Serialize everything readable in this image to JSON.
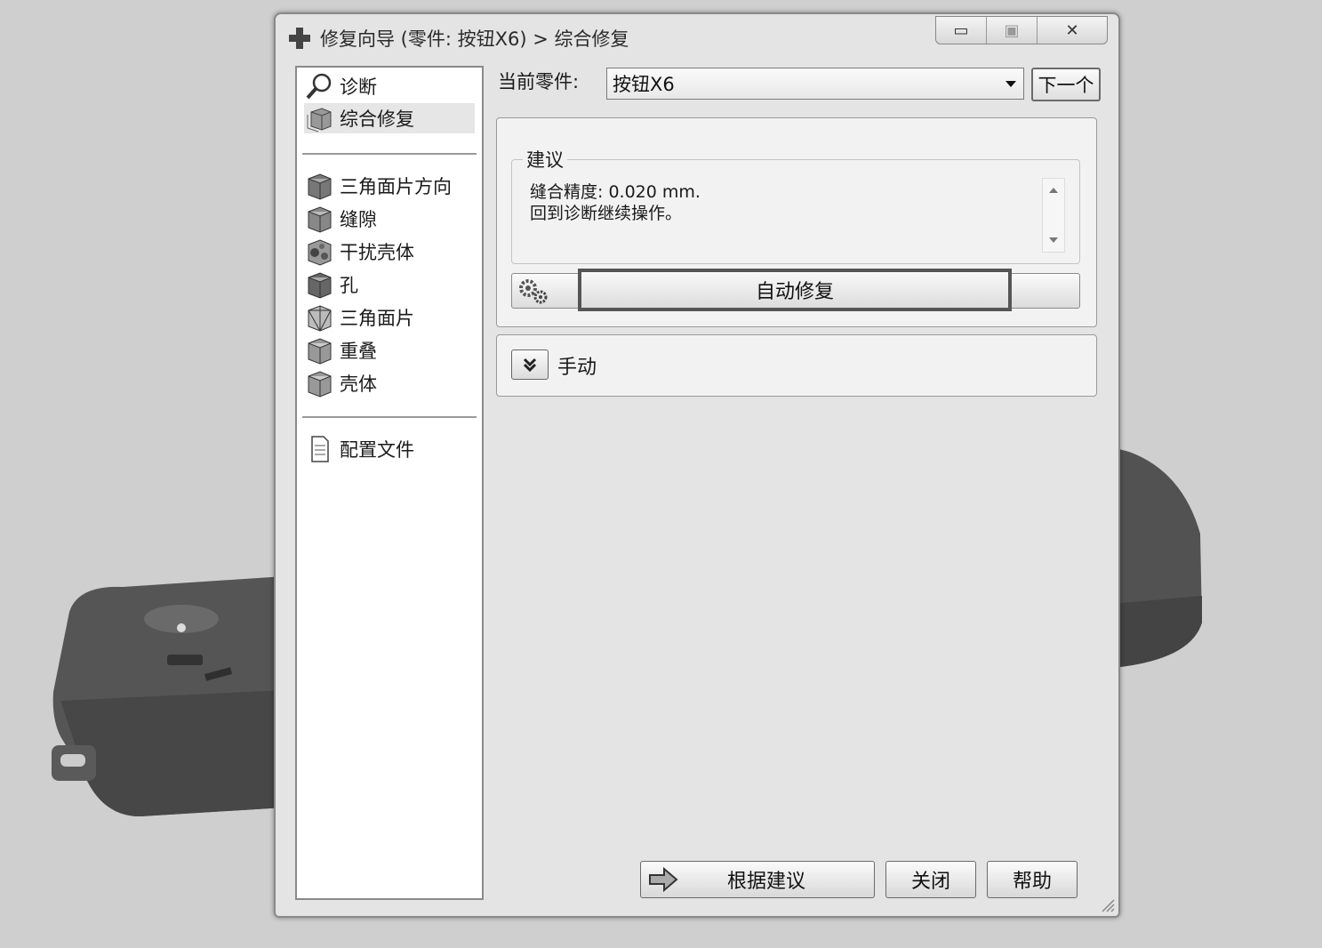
{
  "window": {
    "title": "修复向导 (零件: 按钮X6) > 综合修复"
  },
  "sidebar": {
    "group1": [
      {
        "label": "诊断",
        "icon": "magnifier-icon"
      },
      {
        "label": "综合修复",
        "icon": "cube-stack-icon",
        "selected": true
      }
    ],
    "group2": [
      {
        "label": "三角面片方向",
        "icon": "cube-icon"
      },
      {
        "label": "缝隙",
        "icon": "cube-icon"
      },
      {
        "label": "干扰壳体",
        "icon": "gear-cube-icon"
      },
      {
        "label": "孔",
        "icon": "cube-icon"
      },
      {
        "label": "三角面片",
        "icon": "wireframe-cube-icon"
      },
      {
        "label": "重叠",
        "icon": "cube-icon"
      },
      {
        "label": "壳体",
        "icon": "cube-icon"
      }
    ],
    "group3": [
      {
        "label": "配置文件",
        "icon": "document-icon"
      }
    ]
  },
  "header": {
    "current_part_label": "当前零件:",
    "current_part_value": "按钮X6",
    "next_label": "下一个"
  },
  "suggestion": {
    "title": "建议",
    "line1": "缝合精度:  0.020 mm.",
    "line2": "回到诊断继续操作。",
    "auto_fix_label": "自动修复"
  },
  "manual": {
    "label": "手动"
  },
  "footer": {
    "suggest_label": "根据建议",
    "close_label": "关闭",
    "help_label": "帮助"
  }
}
